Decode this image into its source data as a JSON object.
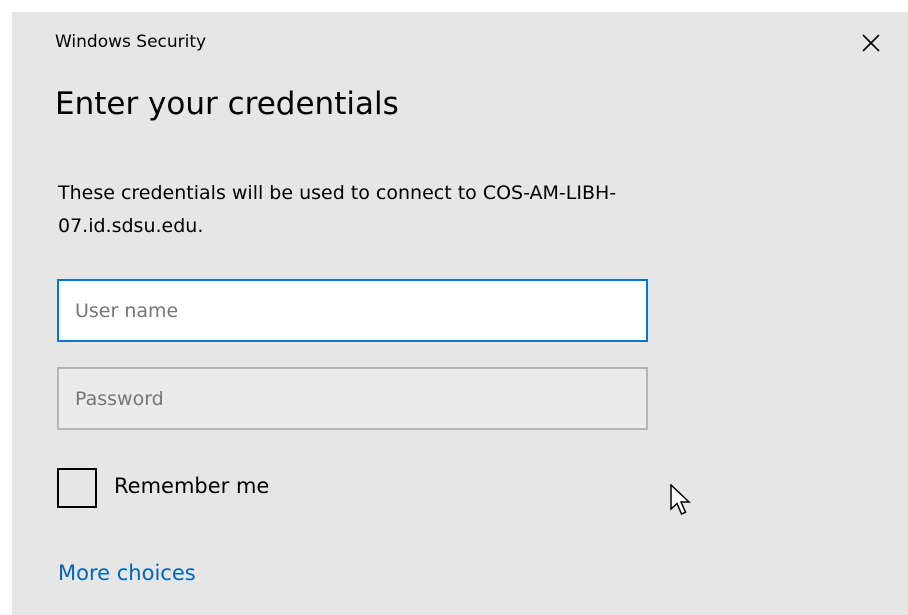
{
  "dialog": {
    "window_title": "Windows Security",
    "heading": "Enter your credentials",
    "message": "These credentials will be used to connect to COS-AM-LIBH-07.id.sdsu.edu.",
    "close_icon": "close-icon"
  },
  "fields": {
    "username": {
      "placeholder": "User name",
      "value": ""
    },
    "password": {
      "placeholder": "Password",
      "value": ""
    }
  },
  "remember": {
    "label": "Remember me",
    "checked": false
  },
  "links": {
    "more_choices": "More choices"
  },
  "colors": {
    "dialog_bg": "#e6e6e6",
    "accent": "#0078d7",
    "link": "#0067b8"
  },
  "pointer": "arrow-cursor-icon"
}
